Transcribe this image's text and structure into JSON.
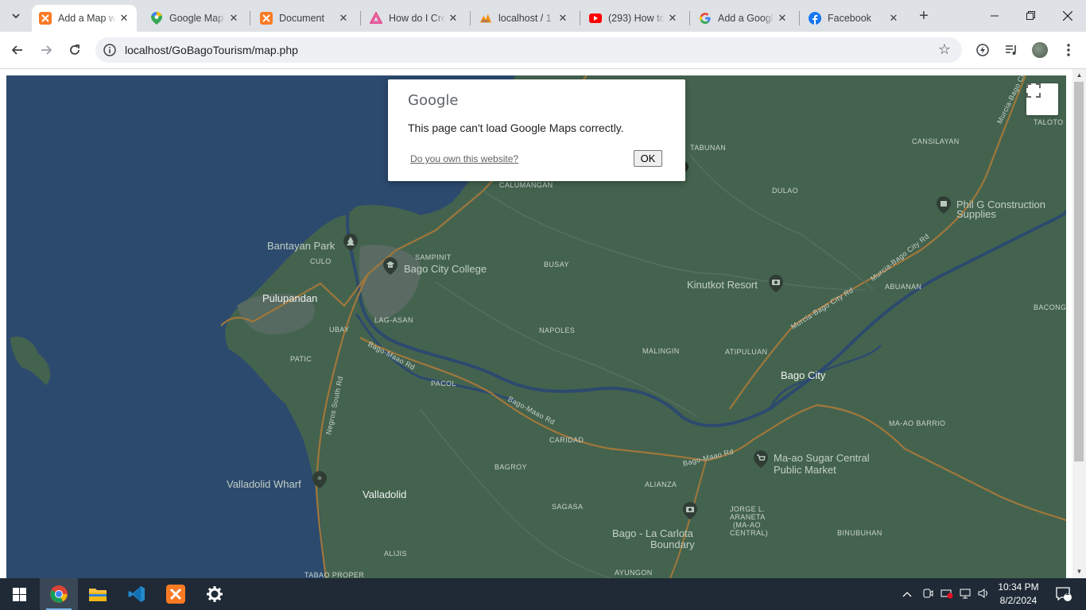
{
  "browser": {
    "tabs": [
      {
        "title": "Add a Map w",
        "icon": "xampp-icon",
        "active": true
      },
      {
        "title": "Google Map",
        "icon": "google-maps-icon",
        "active": false
      },
      {
        "title": "Document",
        "icon": "xampp-icon",
        "active": false
      },
      {
        "title": "How do I Cre",
        "icon": "stackblitz-icon",
        "active": false
      },
      {
        "title": "localhost / 1",
        "icon": "phpmyadmin-icon",
        "active": false
      },
      {
        "title": "(293) How to",
        "icon": "youtube-icon",
        "active": false
      },
      {
        "title": "Add a Googl",
        "icon": "google-icon",
        "active": false
      },
      {
        "title": "Facebook",
        "icon": "facebook-icon",
        "active": false
      }
    ],
    "url": "localhost/GoBagoTourism/map.php"
  },
  "dialog": {
    "logo": "Google",
    "message": "This page can't load Google Maps correctly.",
    "link": "Do you own this website?",
    "ok": "OK"
  },
  "map": {
    "places": {
      "bantayan": "Bantayan Park",
      "bago_college": "Bago City College",
      "pulupandan": "Pulupandan",
      "kinutkot": "Kinutkot Resort",
      "phil_g": "Phil G Construction",
      "phil_g2": "Supplies",
      "bago_city": "Bago City",
      "maao_sugar": "Ma-ao Sugar Central",
      "maao_market": "Public Market",
      "valladolid_wharf": "Valladolid Wharf",
      "valladolid": "Valladolid",
      "boundary1": "Bago - La Carlota",
      "boundary2": "Boundary"
    },
    "barangays": {
      "tabunan": "TABUNAN",
      "calumangan": "CALUMANGAN",
      "dulao": "DULAO",
      "cansilayan": "CANSILAYAN",
      "taloto": "TALOTO",
      "culo": "CULO",
      "sampinit": "SAMPINIT",
      "busay": "BUSAY",
      "abuanan": "ABUANAN",
      "bacong": "BACONG-",
      "ubay": "UBAY",
      "lagasan": "LAG-ASAN",
      "napoles": "NAPOLES",
      "malingin": "MALINGIN",
      "atipuluan": "ATIPULUAN",
      "patic": "PATIC",
      "pacol": "PACOL",
      "maao_barrio": "MA-AO BARRIO",
      "caridad": "CARIDAD",
      "bagroy": "BAGROY",
      "alianza": "ALIANZA",
      "sagasa": "SAGASA",
      "jorge1": "JORGE L.",
      "jorge2": "ARANETA",
      "jorge3": "(MA-AO",
      "jorge4": "CENTRAL)",
      "binubuhan": "BINUBUHAN",
      "alijis": "ALIJIS",
      "tabao": "TABAO PROPER",
      "ayungon": "AYUNGON"
    },
    "roads": {
      "bago_maao1": "Bago-Maao Rd",
      "bago_maao2": "Bago-Maao Rd",
      "bago_maao3": "Bago-Maao Rd",
      "murcia1": "Murcia-Bago City Rd",
      "murcia2": "Murcia-Bago City Rd",
      "murcia3": "Murcia-Bago City Rd",
      "negros_south": "Negros South Rd"
    }
  },
  "taskbar": {
    "time": "10:34 PM",
    "date": "8/2/2024",
    "notifications": "1"
  }
}
